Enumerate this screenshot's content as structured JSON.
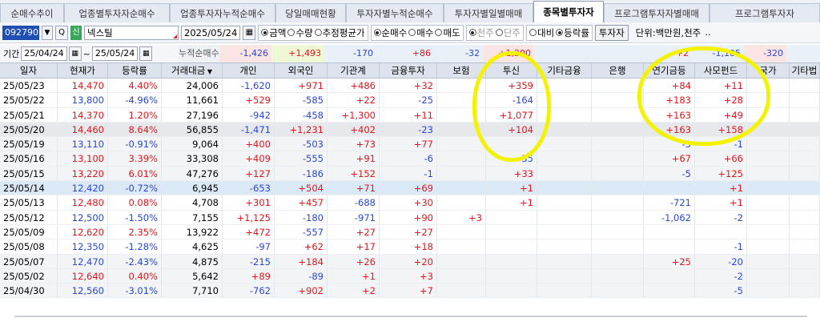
{
  "tabs": [
    "순매수추이",
    "업종별투자자순매수",
    "업종투자자누적순매수",
    "당일매매현황",
    "투자자별누적순매수",
    "투자자별일별매매",
    "종목별투자자",
    "프로그램투자자별매매",
    "프로그램투자자"
  ],
  "active_tab": 6,
  "toolbar": {
    "code": "092790",
    "new_badge": "신",
    "stock_name": "넥스틸",
    "date": "2025/05/24",
    "group1": [
      {
        "label": "금액",
        "on": true
      },
      {
        "label": "수량",
        "on": false
      },
      {
        "label": "추정평균가",
        "on": false
      }
    ],
    "group2": [
      {
        "label": "순매수",
        "on": true
      },
      {
        "label": "매수",
        "on": false
      },
      {
        "label": "매도",
        "on": false
      }
    ],
    "group3": [
      {
        "label": "천주",
        "on": true
      },
      {
        "label": "단주",
        "on": false
      }
    ],
    "group4": [
      {
        "label": "대비",
        "on": false
      },
      {
        "label": "등락률",
        "on": true
      }
    ],
    "investor_button": "투자자",
    "unit_label": "단위:백만원,천주",
    "more": "‥"
  },
  "period": {
    "label": "기간",
    "start": "25/04/24",
    "tilde": "~",
    "end": "25/05/24",
    "cumulative_label": "누적순매수",
    "sums": [
      "-1,426",
      "+1,493",
      "-170",
      "+86",
      "-32",
      "+1,200",
      "",
      "",
      "+2",
      "-1,105",
      "-320",
      "",
      ""
    ]
  },
  "columns": [
    "일자",
    "현재가",
    "등락률",
    "거래대금",
    "개인",
    "외국인",
    "기관계",
    "금융투자",
    "보험",
    "투신",
    "기타금융",
    "은행",
    "연기금등",
    "사모펀드",
    "국가",
    "기타법"
  ],
  "rows": [
    [
      "25/05/23",
      "14,470",
      "4.40%",
      "24,006",
      "-1,620",
      "+971",
      "+486",
      "+32",
      "",
      "+359",
      "",
      "",
      "+84",
      "+11",
      "",
      ""
    ],
    [
      "25/05/22",
      "13,800",
      "-4.96%",
      "11,661",
      "+529",
      "-585",
      "+22",
      "-25",
      "",
      "-164",
      "",
      "",
      "+183",
      "+28",
      "",
      ""
    ],
    [
      "25/05/21",
      "14,370",
      "1.20%",
      "27,196",
      "-942",
      "-458",
      "+1,300",
      "+11",
      "",
      "+1,077",
      "",
      "",
      "+163",
      "+49",
      "",
      ""
    ],
    [
      "25/05/20",
      "14,460",
      "8.64%",
      "56,855",
      "-1,471",
      "+1,231",
      "+402",
      "-23",
      "",
      "+104",
      "",
      "",
      "+163",
      "+158",
      "",
      ""
    ],
    [
      "25/05/19",
      "13,110",
      "-0.91%",
      "9,064",
      "+400",
      "-503",
      "+73",
      "+77",
      "",
      "",
      "",
      "",
      "-3",
      "-1",
      "",
      ""
    ],
    [
      "25/05/16",
      "13,100",
      "3.39%",
      "33,308",
      "+409",
      "-555",
      "+91",
      "-6",
      "",
      "-35",
      "",
      "",
      "+67",
      "+66",
      "",
      ""
    ],
    [
      "25/05/15",
      "13,220",
      "6.01%",
      "47,276",
      "+127",
      "-186",
      "+152",
      "-1",
      "",
      "+33",
      "",
      "",
      "-5",
      "+125",
      "",
      ""
    ],
    [
      "25/05/14",
      "12,420",
      "-0.72%",
      "6,945",
      "-653",
      "+504",
      "+71",
      "+69",
      "",
      "+1",
      "",
      "",
      "",
      "+1",
      "",
      ""
    ],
    [
      "25/05/13",
      "12,480",
      "0.08%",
      "4,708",
      "+301",
      "+457",
      "-688",
      "+30",
      "",
      "+1",
      "",
      "",
      "-721",
      "+1",
      "",
      ""
    ],
    [
      "25/05/12",
      "12,500",
      "-1.50%",
      "7,155",
      "+1,125",
      "-180",
      "-971",
      "+90",
      "+3",
      "",
      "",
      "",
      "-1,062",
      "-2",
      "",
      ""
    ],
    [
      "25/05/09",
      "12,620",
      "2.35%",
      "13,922",
      "+472",
      "-557",
      "+27",
      "+27",
      "",
      "",
      "",
      "",
      "",
      "",
      "",
      ""
    ],
    [
      "25/05/08",
      "12,350",
      "-1.28%",
      "4,625",
      "-97",
      "+62",
      "+17",
      "+18",
      "",
      "",
      "",
      "",
      "",
      "-1",
      "",
      ""
    ],
    [
      "25/05/07",
      "12,470",
      "-2.43%",
      "4,875",
      "-215",
      "+184",
      "+26",
      "+20",
      "",
      "",
      "",
      "",
      "+25",
      "-20",
      "",
      ""
    ],
    [
      "25/05/02",
      "12,640",
      "0.40%",
      "5,642",
      "+89",
      "-89",
      "+1",
      "+3",
      "",
      "",
      "",
      "",
      "",
      "-2",
      "",
      ""
    ],
    [
      "25/04/30",
      "12,560",
      "-3.01%",
      "7,710",
      "-762",
      "+902",
      "+2",
      "+7",
      "",
      "",
      "",
      "",
      "",
      "-5",
      "",
      ""
    ]
  ],
  "row_styles": [
    "g1",
    "g1",
    "g1",
    "dk",
    "g2",
    "g2",
    "g2",
    "sel",
    "g1",
    "g1",
    "g1",
    "g1",
    "g2",
    "g2",
    "g2"
  ],
  "colors": {
    "up": "#e0161c",
    "down": "#2a46d6",
    "highlight": "#f3f200",
    "selected_row": "#dbe9f7"
  }
}
